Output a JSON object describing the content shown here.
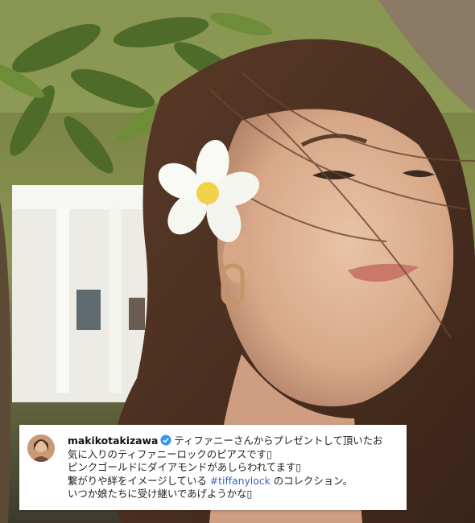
{
  "post": {
    "username": "makikotakizawa",
    "caption_line1": "ティファニーさんからプレゼントして頂いたお",
    "caption_line2": "気に入りのティファニーロックのピアスです",
    "caption_line3": "ピンクゴールドにダイアモンドがあしらわれてます",
    "caption_line4a": "繋がりや絆をイメージしている ",
    "hashtag": "#tiffanylock",
    "caption_line4b": " のコレクション。",
    "caption_line5": "いつか娘たちに受け継いであげようかな",
    "emoji_placeholder": "▯"
  },
  "colors": {
    "hashtag": "#3b63c4",
    "verified": "#3897f0"
  },
  "icons": {
    "verified": "verified-badge-icon"
  }
}
